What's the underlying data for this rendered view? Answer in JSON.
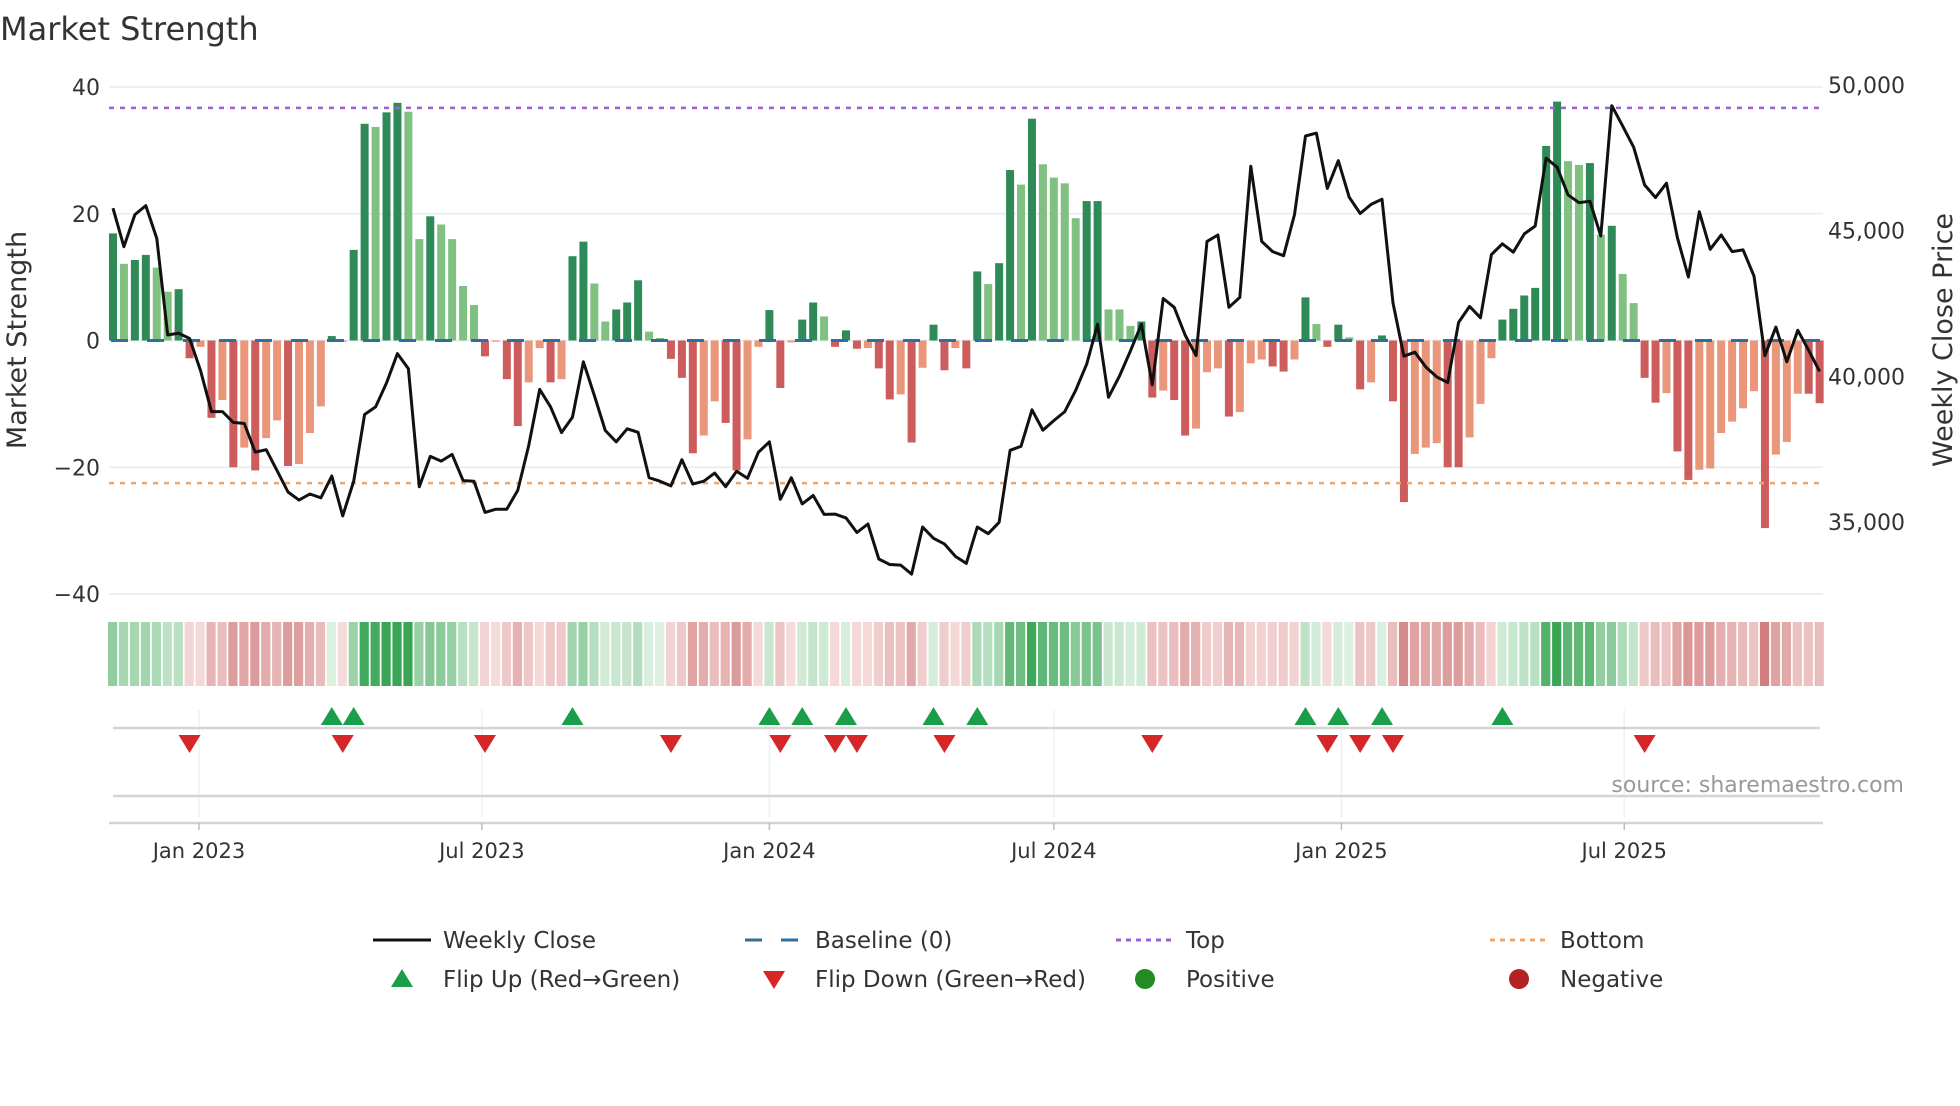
{
  "chart_data": {
    "type": "bar",
    "title": "Market Strength",
    "ylabel": "Market Strength",
    "y2label": "Weekly Close Price",
    "ylim": [
      -40,
      40
    ],
    "y2lim": [
      32550,
      50000
    ],
    "yticks": [
      40,
      20,
      0,
      -20,
      -40
    ],
    "ytick_labels": [
      "40",
      "20",
      "0",
      "−20",
      "−40"
    ],
    "y2ticks": [
      50000,
      45000,
      40000,
      35000
    ],
    "y2tick_labels": [
      "50,000",
      "45,000",
      "40,000",
      "35,000"
    ],
    "xticks": [
      "2023-01-01",
      "2023-07-01",
      "2024-01-01",
      "2024-07-01",
      "2025-01-01",
      "2025-07-01"
    ],
    "xtick_labels": [
      "Jan 2023",
      "Jul 2023",
      "Jan 2024",
      "Jul 2024",
      "Jan 2025",
      "Jul 2025"
    ],
    "start_date": "2022-11-07",
    "interval_days": 7,
    "grid": true,
    "top_level": 36.7,
    "bottom_level": -22.5,
    "baseline": 0,
    "strength": [
      16.9,
      12.1,
      12.7,
      13.5,
      11.5,
      7.7,
      8.1,
      -2.8,
      -1,
      -12.2,
      -9.4,
      -20,
      -16.9,
      -20.5,
      -15.4,
      -12.6,
      -19.8,
      -19.5,
      -14.6,
      -10.4,
      0.7,
      -0.2,
      14.3,
      34.2,
      33.7,
      36,
      37.5,
      36.1,
      16,
      19.6,
      18.3,
      16,
      8.6,
      5.6,
      -2.5,
      -0.2,
      -6.1,
      -13.5,
      -6.6,
      -1.2,
      -6.6,
      -6.1,
      13.3,
      15.6,
      9,
      3,
      4.9,
      6,
      9.5,
      1.4,
      0.4,
      -2.9,
      -5.9,
      -17.8,
      -15,
      -9.6,
      -13,
      -20.5,
      -15.6,
      -1,
      4.8,
      -7.5,
      -0.3,
      3.3,
      6,
      3.8,
      -1,
      1.6,
      -1.3,
      -1.2,
      -4.4,
      -9.3,
      -8.5,
      -16.1,
      -4.3,
      2.5,
      -4.7,
      -1.2,
      -4.4,
      10.9,
      8.9,
      12.2,
      26.9,
      24.6,
      35,
      27.8,
      25.7,
      24.8,
      19.3,
      22,
      22,
      4.9,
      4.9,
      2.3,
      3,
      -9,
      -7.9,
      -9.4,
      -15,
      -13.9,
      -5,
      -4.4,
      -12,
      -11.3,
      -3.6,
      -3,
      -4.1,
      -4.9,
      -3,
      6.8,
      2.6,
      -1,
      2.5,
      0.5,
      -7.7,
      -6.6,
      0.8,
      -9.6,
      -25.5,
      -17.9,
      -16.9,
      -16.2,
      -20,
      -20,
      -15.3,
      -10,
      -2.8,
      3.3,
      5,
      7.1,
      8.3,
      30.7,
      37.7,
      28.3,
      27.7,
      28,
      16.7,
      18.1,
      10.5,
      5.9,
      -5.9,
      -9.8,
      -8.3,
      -17.5,
      -22,
      -20.4,
      -20.2,
      -14.6,
      -12.8,
      -10.7,
      -8,
      -29.6,
      -18,
      -16,
      -8.4,
      -8.4,
      -9.9
    ],
    "shade": [
      "D",
      "L",
      "D",
      "D",
      "L",
      "L",
      "D",
      "D",
      "L",
      "D",
      "L",
      "D",
      "L",
      "D",
      "L",
      "L",
      "D",
      "L",
      "L",
      "L",
      "D",
      "L",
      "D",
      "D",
      "L",
      "D",
      "D",
      "L",
      "L",
      "D",
      "L",
      "L",
      "L",
      "L",
      "D",
      "L",
      "D",
      "D",
      "L",
      "L",
      "D",
      "L",
      "D",
      "D",
      "L",
      "L",
      "D",
      "D",
      "D",
      "L",
      "L",
      "D",
      "D",
      "D",
      "L",
      "L",
      "D",
      "D",
      "L",
      "L",
      "D",
      "D",
      "L",
      "D",
      "D",
      "L",
      "D",
      "D",
      "D",
      "L",
      "D",
      "D",
      "L",
      "D",
      "L",
      "D",
      "D",
      "L",
      "D",
      "D",
      "L",
      "D",
      "D",
      "L",
      "D",
      "L",
      "L",
      "L",
      "L",
      "D",
      "D",
      "L",
      "L",
      "L",
      "D",
      "D",
      "L",
      "D",
      "D",
      "L",
      "L",
      "L",
      "D",
      "L",
      "L",
      "L",
      "D",
      "D",
      "L",
      "D",
      "L",
      "D",
      "D",
      "L",
      "D",
      "L",
      "D",
      "D",
      "D",
      "L",
      "L",
      "L",
      "D",
      "D",
      "L",
      "L",
      "L",
      "D",
      "D",
      "D",
      "D",
      "D",
      "D",
      "L",
      "L",
      "D",
      "L",
      "D",
      "L",
      "L",
      "D",
      "D",
      "L",
      "D",
      "D",
      "L",
      "L",
      "L",
      "L",
      "L",
      "L",
      "D",
      "L",
      "L",
      "L",
      "D",
      "D"
    ],
    "weekly_close": [
      45770,
      44450,
      45550,
      45860,
      44730,
      41420,
      41480,
      41300,
      40200,
      38790,
      38790,
      38420,
      38380,
      37400,
      37480,
      36760,
      36030,
      35750,
      35960,
      35830,
      36580,
      35210,
      36400,
      38690,
      38950,
      39770,
      40780,
      40260,
      36210,
      37250,
      37090,
      37320,
      36420,
      36400,
      35330,
      35440,
      35440,
      36090,
      37620,
      39550,
      38950,
      38070,
      38600,
      40500,
      39340,
      38140,
      37750,
      38200,
      38080,
      36520,
      36400,
      36240,
      37140,
      36300,
      36400,
      36680,
      36210,
      36740,
      36500,
      37400,
      37750,
      35780,
      36520,
      35620,
      35910,
      35260,
      35270,
      35140,
      34640,
      34930,
      33730,
      33540,
      33520,
      33210,
      34830,
      34440,
      34250,
      33820,
      33580,
      34830,
      34600,
      34990,
      37460,
      37600,
      38850,
      38150,
      38480,
      38790,
      39520,
      40420,
      41790,
      39280,
      40010,
      40870,
      41790,
      39710,
      42670,
      42370,
      41420,
      40710,
      44630,
      44850,
      42370,
      42710,
      47210,
      44630,
      44280,
      44140,
      45550,
      48250,
      48350,
      46450,
      47400,
      46150,
      45590,
      45900,
      46080,
      42520,
      40690,
      40830,
      40320,
      39980,
      39790,
      41850,
      42400,
      42010,
      44180,
      44550,
      44260,
      44890,
      45160,
      47490,
      47180,
      46230,
      45960,
      46010,
      44820,
      49290,
      48590,
      47860,
      46570,
      46140,
      46630,
      44760,
      43410,
      45650,
      44360,
      44850,
      44280,
      44340,
      43440,
      40710,
      41690,
      40500,
      41580,
      40890,
      40170
    ],
    "flip_up_weeks": [
      21,
      23,
      43,
      61,
      64,
      68,
      76,
      80,
      110,
      113,
      117,
      128
    ],
    "flip_down_weeks": [
      8,
      22,
      35,
      52,
      62,
      67,
      69,
      77,
      96,
      112,
      115,
      118,
      141
    ],
    "legend": {
      "placement": "bottom",
      "items": [
        {
          "label": "Weekly Close",
          "kind": "line",
          "color": "#111111"
        },
        {
          "label": "Baseline (0)",
          "kind": "dash",
          "color": "#2f6f9f"
        },
        {
          "label": "Top",
          "kind": "dot",
          "color": "#9b5fd6"
        },
        {
          "label": "Bottom",
          "kind": "dot",
          "color": "#f0a56a"
        },
        {
          "label": "Flip Up (Red→Green)",
          "kind": "tri-up",
          "color": "#1a9e4a"
        },
        {
          "label": "Flip Down (Green→Red)",
          "kind": "tri-down",
          "color": "#d62728"
        },
        {
          "label": "Positive",
          "kind": "circle",
          "color": "#228b22"
        },
        {
          "label": "Negative",
          "kind": "circle",
          "color": "#b22222"
        }
      ]
    },
    "source": "source: sharemaestro.com",
    "colors": {
      "pos_dark": "#2e8b57",
      "pos_light": "#80c080",
      "neg_dark": "#cd5c5c",
      "neg_light": "#e9967a",
      "grid": "#ebeff3",
      "line": "#111111"
    }
  }
}
